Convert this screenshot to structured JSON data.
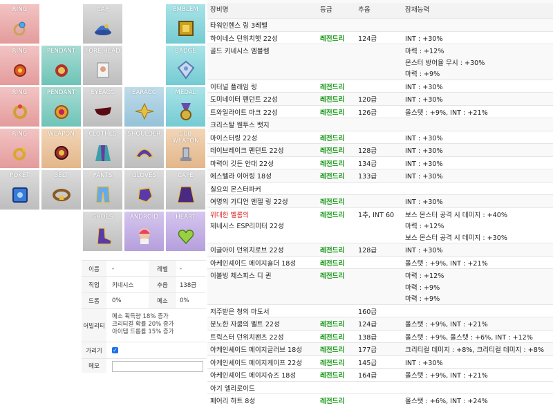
{
  "slots": {
    "ring1": "RING",
    "cap": "CAP",
    "emblem": "EMBLEM",
    "ring2": "RING",
    "pendant1": "PENDANT",
    "forehead": "FORE HEAD",
    "badge": "BADGE",
    "ring3": "RING",
    "pendant2": "PENDANT",
    "eyeacc": "EYEACC",
    "earacc": "EARACC",
    "medal": "MEDAL",
    "ring4": "RING",
    "weapon": "WEAPON",
    "clothes": "CLOTHES",
    "shoulder": "SHOULDER",
    "subweapon": "SUB\nWEAPON",
    "poket": "POKET",
    "belt": "BELT",
    "pants": "PANTS",
    "gloves": "GLOVES",
    "cape": "CAPE",
    "shoes": "SHOES",
    "android": "ANDROID",
    "heart": "HEART"
  },
  "info": {
    "name_label": "이름",
    "name_value": "-",
    "level_label": "레벨",
    "level_value": "-",
    "job_label": "직업",
    "job_value": "키네시스",
    "force_label": "추옵",
    "force_value": "138급",
    "drop_label": "드롭",
    "drop_value": "0%",
    "meso_label": "메소",
    "meso_value": "0%",
    "ability_label": "어빌리티",
    "ability_value": "메소 획득량 18% 증가\n크리티컬 확률 20% 증가\n아이템 드롭률 15% 증가",
    "pet_label": "가리기",
    "memo_label": "메모"
  },
  "list": {
    "headers": {
      "name": "장비명",
      "grade": "등급",
      "star": "추옵",
      "potential": "잠재능력"
    },
    "rows": [
      {
        "name": "타워인헨스 링 3레벨",
        "grade": "",
        "star": "",
        "pot": ""
      },
      {
        "name": "하이네스 던위치햇 22성",
        "grade": "레전드리",
        "star": "124급",
        "pot": "INT : +30%"
      },
      {
        "name": "골드 키네시스 엠블렘",
        "grade": "",
        "star": "",
        "pot": "마력 : +12%\n몬스터 방어율 무시 : +30%\n마력 : +9%"
      },
      {
        "name": "이터널 플래임 링",
        "grade": "레전드리",
        "star": "",
        "pot": "INT : +30%"
      },
      {
        "name": "도미네이터 펜던트 22성",
        "grade": "레전드리",
        "star": "120급",
        "pot": "INT : +30%"
      },
      {
        "name": "트와일라이트 마크 22성",
        "grade": "레전드리",
        "star": "126급",
        "pot": "올스탯 : +9%, INT : +21%"
      },
      {
        "name": "크리스탈 웬투스 뱃지",
        "grade": "",
        "star": "",
        "pot": ""
      },
      {
        "name": "마이스터링 22성",
        "grade": "레전드리",
        "star": "",
        "pot": "INT : +30%"
      },
      {
        "name": "데이브레이크 펜던트 22성",
        "grade": "레전드리",
        "star": "128급",
        "pot": "INT : +30%"
      },
      {
        "name": "마력이 깃든 안대 22성",
        "grade": "레전드리",
        "star": "134급",
        "pot": "INT : +30%"
      },
      {
        "name": "에스텔라 이어링 18성",
        "grade": "레전드리",
        "star": "133급",
        "pot": "INT : +30%"
      },
      {
        "name": "칠요의 몬스터파커",
        "grade": "",
        "star": "",
        "pot": ""
      },
      {
        "name": "여명의 가디언 엔젤 링 22성",
        "grade": "레전드리",
        "star": "",
        "pot": "INT : +30%"
      },
      {
        "name": "위대한 벨롬의\n제네시스 ESP리미터 22성",
        "grade": "레전드리",
        "star": "1추, INT 60",
        "pot": "보스 몬스터 공격 시 데미지 : +40%\n마력 : +12%\n보스 몬스터 공격 시 데미지 : +30%"
      },
      {
        "name": "이글아이 던위치로브 22성",
        "grade": "레전드리",
        "star": "128급",
        "pot": "INT : +30%"
      },
      {
        "name": "아케인셰이드 메이지숄더 18성",
        "grade": "레전드리",
        "star": "",
        "pot": "올스탯 : +9%, INT : +21%"
      },
      {
        "name": "이볼빙 체스피스 디 퀸",
        "grade": "레전드리",
        "star": "",
        "pot": "마력 : +12%\n마력 : +9%\n마력 : +9%"
      },
      {
        "name": "저주받은 청의 마도서",
        "grade": "",
        "star": "160급",
        "pot": ""
      },
      {
        "name": "분노한 자쿰의 벨트 22성",
        "grade": "레전드리",
        "star": "124급",
        "pot": "올스탯 : +9%, INT : +21%"
      },
      {
        "name": "트릭스터 던위치팬츠 22성",
        "grade": "레전드리",
        "star": "138급",
        "pot": "올스탯 : +9%, 올스탯 : +6%, INT : +12%"
      },
      {
        "name": "아케인셰이드 메이지글러브 18성",
        "grade": "레전드리",
        "star": "177급",
        "pot": "크리티컬 데미지 : +8%, 크리티컬 데미지 : +8%"
      },
      {
        "name": "아케인셰이드 메이지케이프 22성",
        "grade": "레전드리",
        "star": "145급",
        "pot": "INT : +30%"
      },
      {
        "name": "아케인셰이드 메이지슈즈 18성",
        "grade": "레전드리",
        "star": "164급",
        "pot": "올스탯 : +9%, INT : +21%"
      },
      {
        "name": "아기 엘리로이드",
        "grade": "",
        "star": "",
        "pot": ""
      },
      {
        "name": "페어리 하트 8성",
        "grade": "레전드리",
        "star": "",
        "pot": "올스탯 : +6%, INT : +24%"
      }
    ]
  },
  "colors": {
    "legendary": "#1a9a1a",
    "highlight_name": "#d92020"
  }
}
